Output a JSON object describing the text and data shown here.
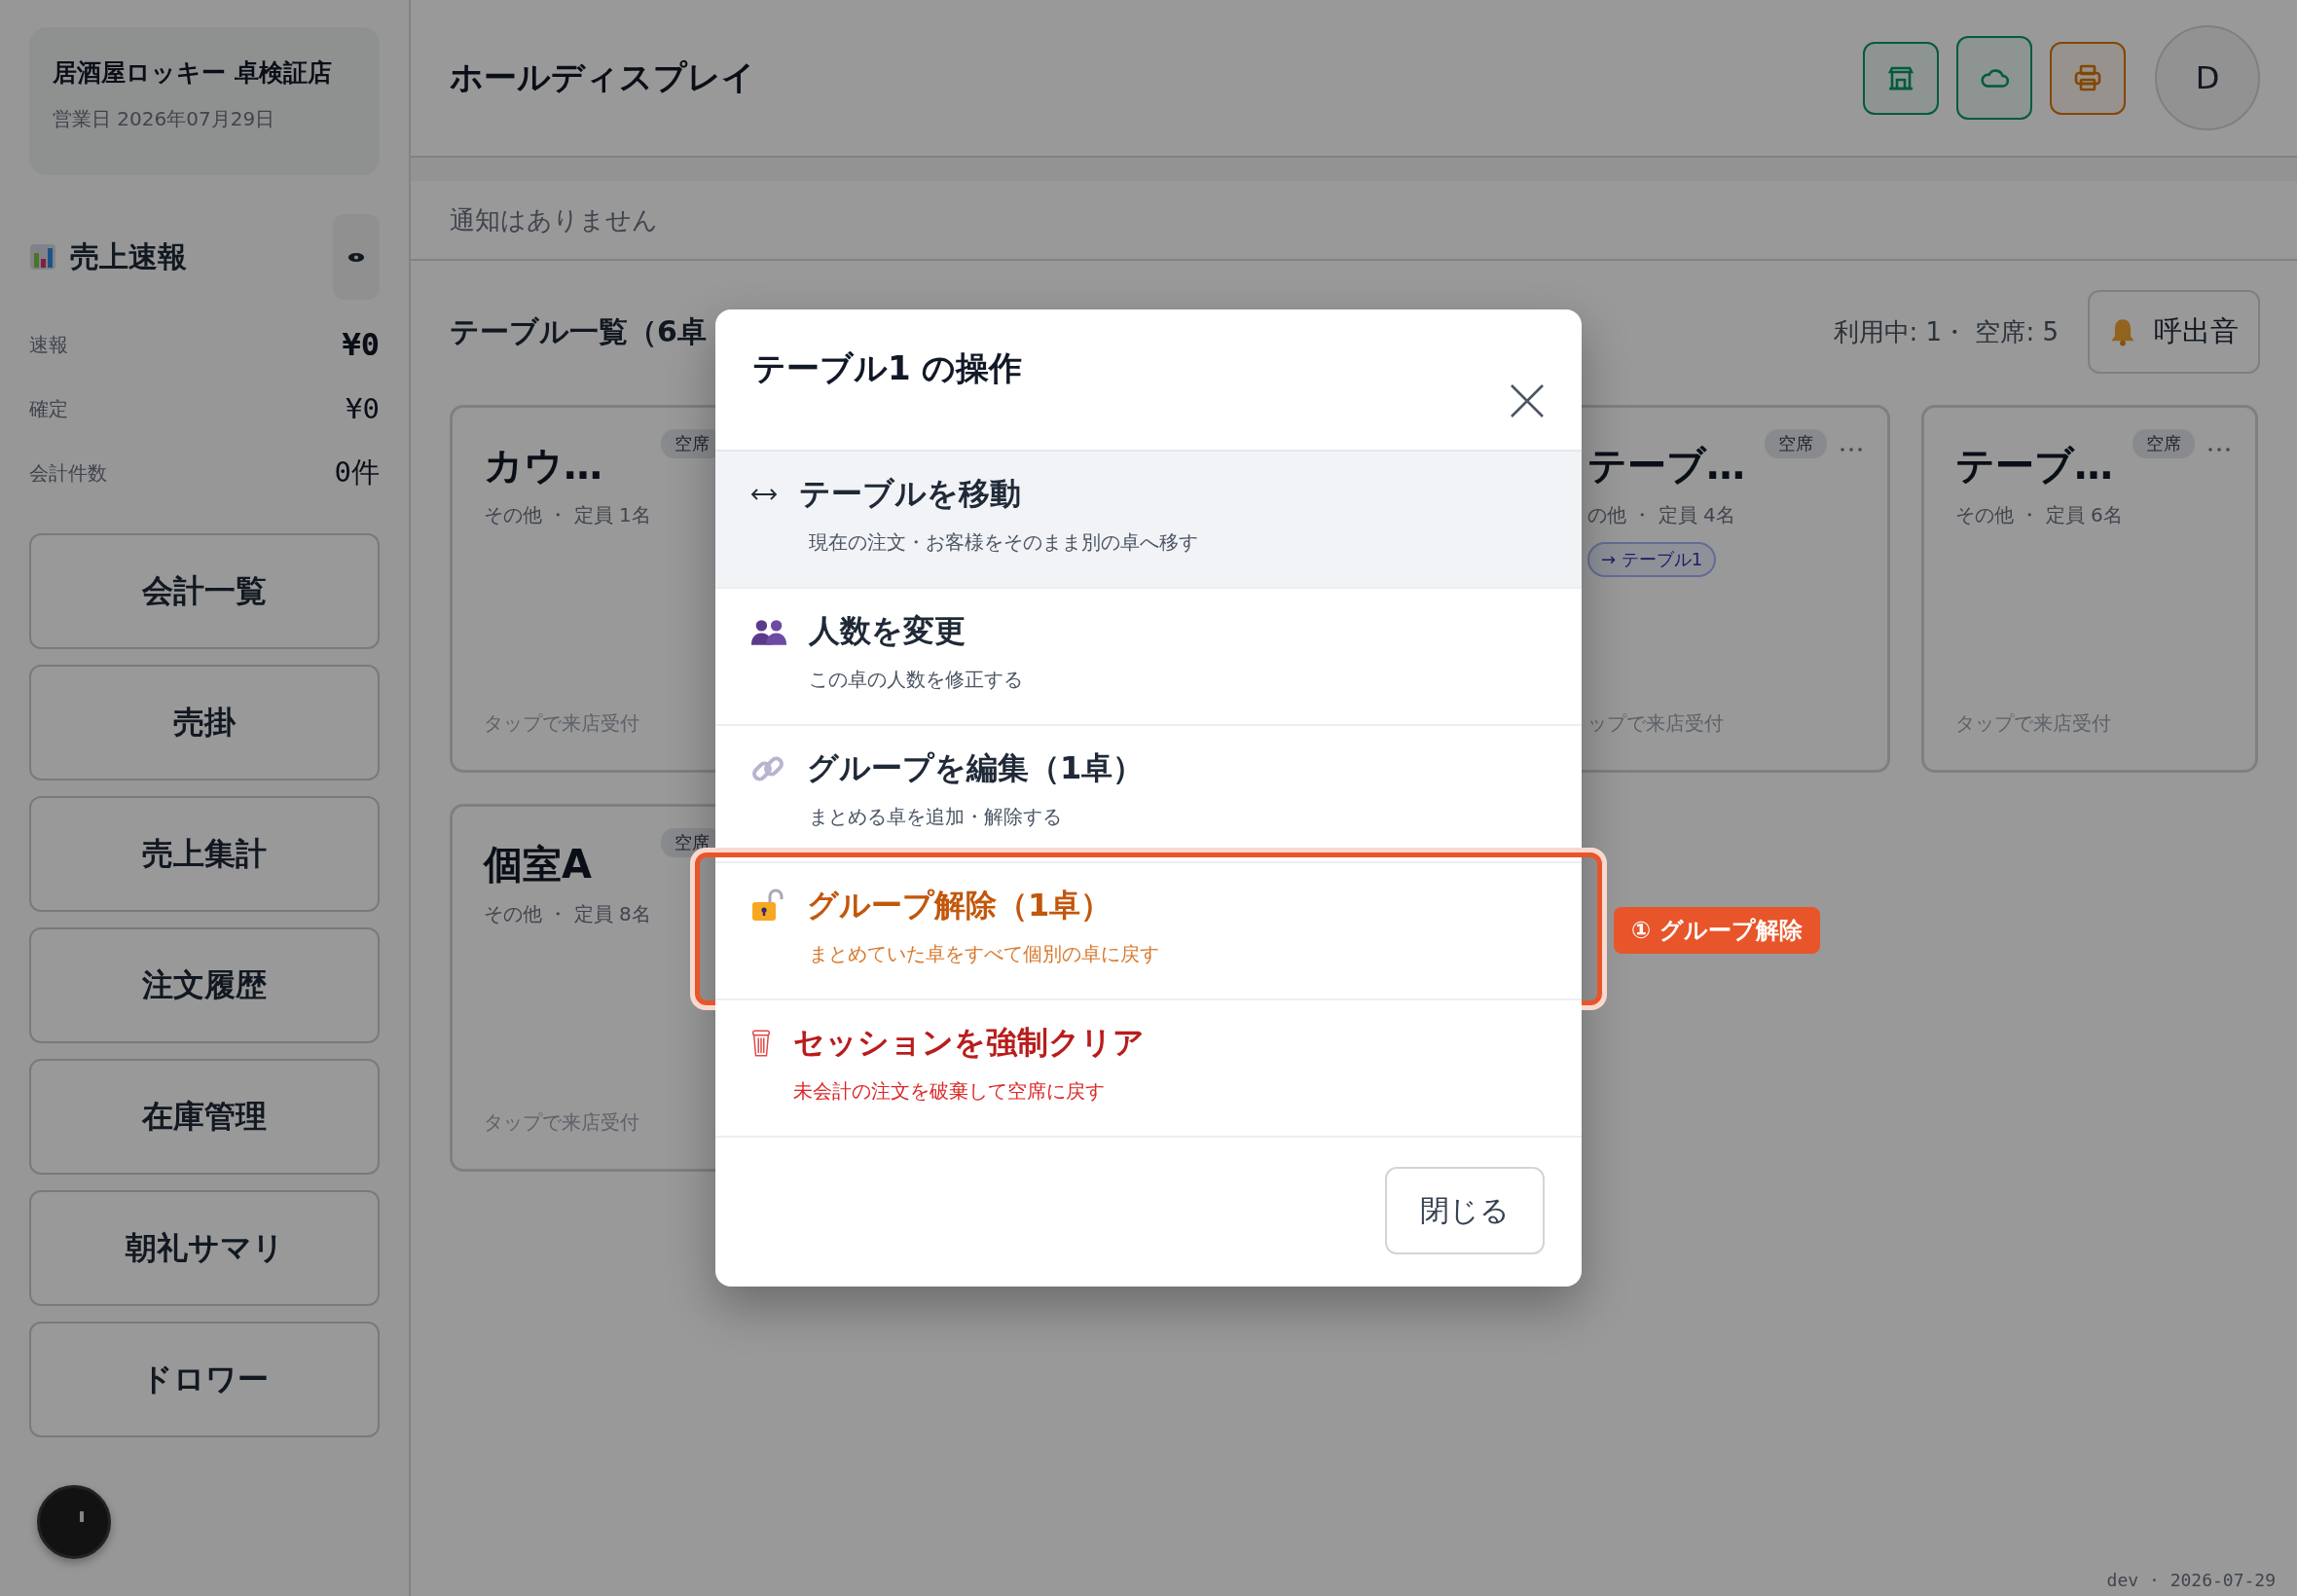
{
  "sidebar": {
    "store_name": "居酒屋ロッキー 卓検証店",
    "business_date": "営業日 2026年07月29日",
    "sales": {
      "title": "売上速報",
      "rows": [
        {
          "label": "速報",
          "value": "¥0",
          "kind": "primary"
        },
        {
          "label": "確定",
          "value": "¥0",
          "kind": "secondary"
        },
        {
          "label": "会計件数",
          "value": "0件",
          "kind": "secondary"
        }
      ]
    },
    "nav": [
      "会計一覧",
      "売掛",
      "売上集計",
      "注文履歴",
      "在庫管理",
      "朝礼サマリ",
      "ドロワー"
    ]
  },
  "header": {
    "title": "ホールディスプレイ",
    "icon_buttons": [
      {
        "kind": "ok"
      },
      {
        "kind": "ok"
      },
      {
        "kind": "warning"
      }
    ],
    "avatar": "D"
  },
  "notification": "通知はありません",
  "tables": {
    "heading": "テーブル一覧（6卓",
    "summary": "利用中: 1・ 空席: 5",
    "chime_button": "呼出音",
    "cards": [
      {
        "name": "カウ…",
        "info": "その他 ・ 定員 1名",
        "status": "空席",
        "hint": "タップで来店受付"
      },
      {
        "name": "テーブ…",
        "info": "の他 ・ 定員 4名",
        "status": "空席",
        "link": "→ テーブル1",
        "hint": "ップで来店受付"
      },
      {
        "name": "テーブ…",
        "info": "その他 ・ 定員 6名",
        "status": "空席",
        "hint": "タップで来店受付"
      },
      {
        "name": "個室A",
        "info": "その他 ・ 定員 8名",
        "status": "空席",
        "hint": "タップで来店受付"
      }
    ]
  },
  "modal": {
    "title": "テーブル1 の操作",
    "items": [
      {
        "kind": "normal",
        "selected": true,
        "title": "テーブルを移動",
        "description": "現在の注文・お客様をそのまま別の卓へ移す"
      },
      {
        "kind": "normal",
        "selected": false,
        "title": "人数を変更",
        "description": "この卓の人数を修正する"
      },
      {
        "kind": "normal",
        "selected": false,
        "title": "グループを編集（1卓）",
        "description": "まとめる卓を追加・解除する"
      },
      {
        "kind": "warning",
        "selected": false,
        "title": "グループ解除（1卓）",
        "description": "まとめていた卓をすべて個別の卓に戻す",
        "annotation": "① グループ解除"
      },
      {
        "kind": "danger",
        "selected": false,
        "title": "セッションを強制クリア",
        "description": "未会計の注文を破棄して空席に戻す"
      }
    ],
    "close_button": "閉じる"
  },
  "footer": "dev · 2026-07-29"
}
